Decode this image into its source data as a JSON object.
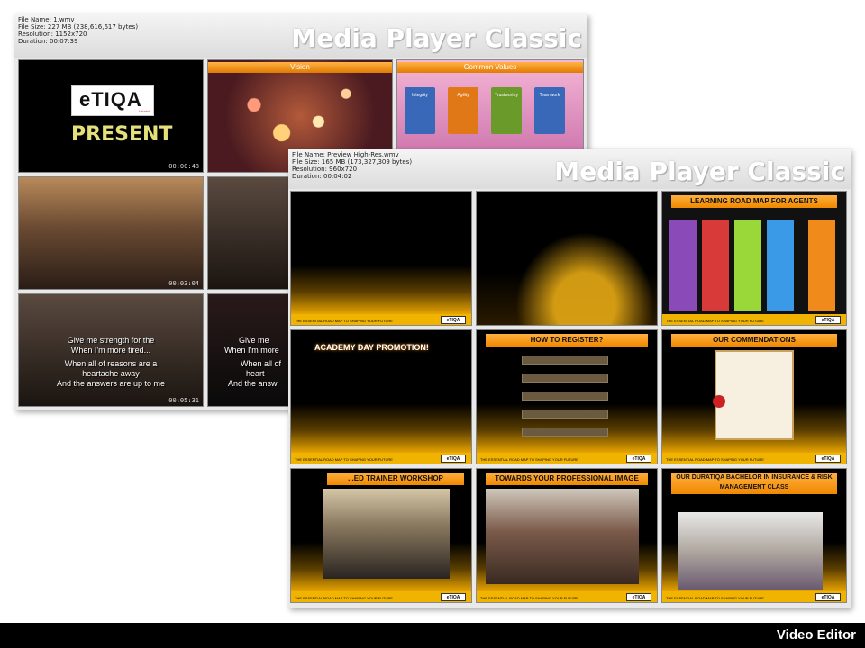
{
  "sheet1": {
    "meta": {
      "file_name": "File Name: 1.wmv",
      "file_size": "File Size: 227 MB (238,616,617 bytes)",
      "resolution": "Resolution: 1152x720",
      "duration": "Duration: 00:07:39"
    },
    "brand": "Media Player Classic",
    "thumbs": {
      "t1": {
        "logo": "eTIQA",
        "logo_sub": "takaful",
        "caption": "PRESENT",
        "timestamp": "00:00:48"
      },
      "t2": {
        "banner": "Vision"
      },
      "t3": {
        "banner": "Common Values",
        "cards": [
          "Integrity",
          "Agility",
          "Trustworthy",
          "Teamwork"
        ]
      },
      "t4": {
        "timestamp": "00:03:04"
      },
      "t7": {
        "lyrics": [
          "Give me strength for the",
          "When I'm more tired...",
          "When all of reasons are a",
          "heartache away",
          "And the answers are up to me"
        ],
        "timestamp": "00:05:31"
      },
      "t8": {
        "lyrics": [
          "Give me",
          "When I'm more",
          "When all of",
          "heart",
          "And the answ"
        ]
      }
    }
  },
  "sheet2": {
    "meta": {
      "file_name": "File Name: Preview High-Res.wmv",
      "file_size": "File Size: 165 MB (173,327,309 bytes)",
      "resolution": "Resolution: 960x720",
      "duration": "Duration: 00:04:02"
    },
    "brand": "Media Player Classic",
    "footer_text": "THE ESSENTIAL ROAD MAP TO SHAPING YOUR FUTURE",
    "footer_logo": "eTIQA",
    "thumbs": {
      "s3": {
        "banner": "LEARNING ROAD MAP FOR AGENTS"
      },
      "s4": {
        "banner": "ACADEMY DAY PROMOTION!"
      },
      "s5": {
        "banner": "HOW TO REGISTER?"
      },
      "s6": {
        "banner": "OUR COMMENDATIONS"
      },
      "s7": {
        "banner": "...ED TRAINER WORKSHOP"
      },
      "s8": {
        "banner": "TOWARDS YOUR PROFESSIONAL IMAGE"
      },
      "s9": {
        "banner": "OUR DURATIQA BACHELOR IN INSURANCE & RISK MANAGEMENT CLASS"
      }
    }
  },
  "bottom_bar": {
    "label": "Video Editor"
  },
  "colors": {
    "gold": "#f0b400",
    "orange_banner": "#f08800",
    "bottom_bar": "#000000"
  }
}
